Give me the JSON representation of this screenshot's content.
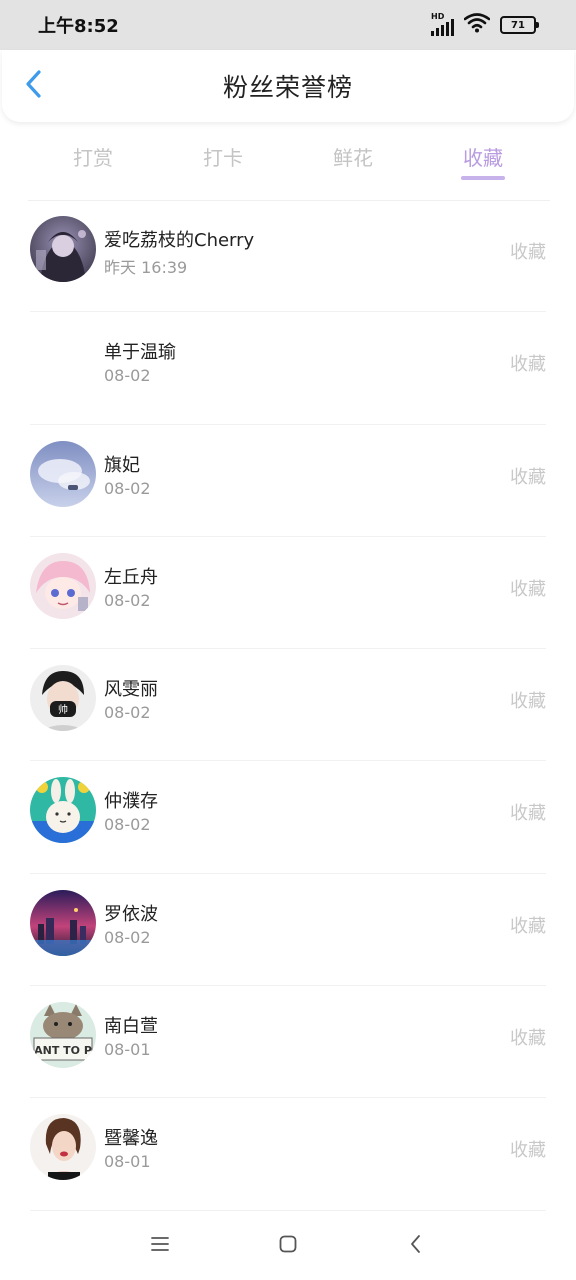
{
  "status_bar": {
    "time": "上午8:52",
    "network_badge": "HD",
    "battery_level": "71",
    "icons": [
      "signal-icon",
      "wifi-icon",
      "battery-icon"
    ]
  },
  "header": {
    "title": "粉丝荣誉榜",
    "back_icon": "chevron-left-icon"
  },
  "tabs": [
    {
      "label": "打赏",
      "active": false
    },
    {
      "label": "打卡",
      "active": false
    },
    {
      "label": "鲜花",
      "active": false
    },
    {
      "label": "收藏",
      "active": true
    }
  ],
  "fans": [
    {
      "name": "爱吃荔枝的Cherry",
      "date": "昨天 16:39",
      "action": "收藏",
      "avatar": "avatar-anime-dark"
    },
    {
      "name": "单于温瑜",
      "date": "08-02",
      "action": "收藏",
      "avatar": "avatar-empty"
    },
    {
      "name": "旗妃",
      "date": "08-02",
      "action": "收藏",
      "avatar": "avatar-sky"
    },
    {
      "name": "左丘舟",
      "date": "08-02",
      "action": "收藏",
      "avatar": "avatar-anime-pink"
    },
    {
      "name": "风雯丽",
      "date": "08-02",
      "action": "收藏",
      "avatar": "avatar-masked-person"
    },
    {
      "name": "仲濮存",
      "date": "08-02",
      "action": "收藏",
      "avatar": "avatar-bunny"
    },
    {
      "name": "罗依波",
      "date": "08-02",
      "action": "收藏",
      "avatar": "avatar-night-city"
    },
    {
      "name": "南白萱",
      "date": "08-01",
      "action": "收藏",
      "avatar": "avatar-cat-sign"
    },
    {
      "name": "暨馨逸",
      "date": "08-01",
      "action": "收藏",
      "avatar": "avatar-woman"
    }
  ],
  "nav_bar": {
    "icons": [
      "menu-icon",
      "home-icon",
      "back-icon"
    ]
  },
  "colors": {
    "accent": "#b89be0",
    "tab_inactive": "#c4c4c4",
    "back_icon": "#3d9be9",
    "action_text": "#c8c8c8",
    "date_text": "#9a9a9a"
  }
}
